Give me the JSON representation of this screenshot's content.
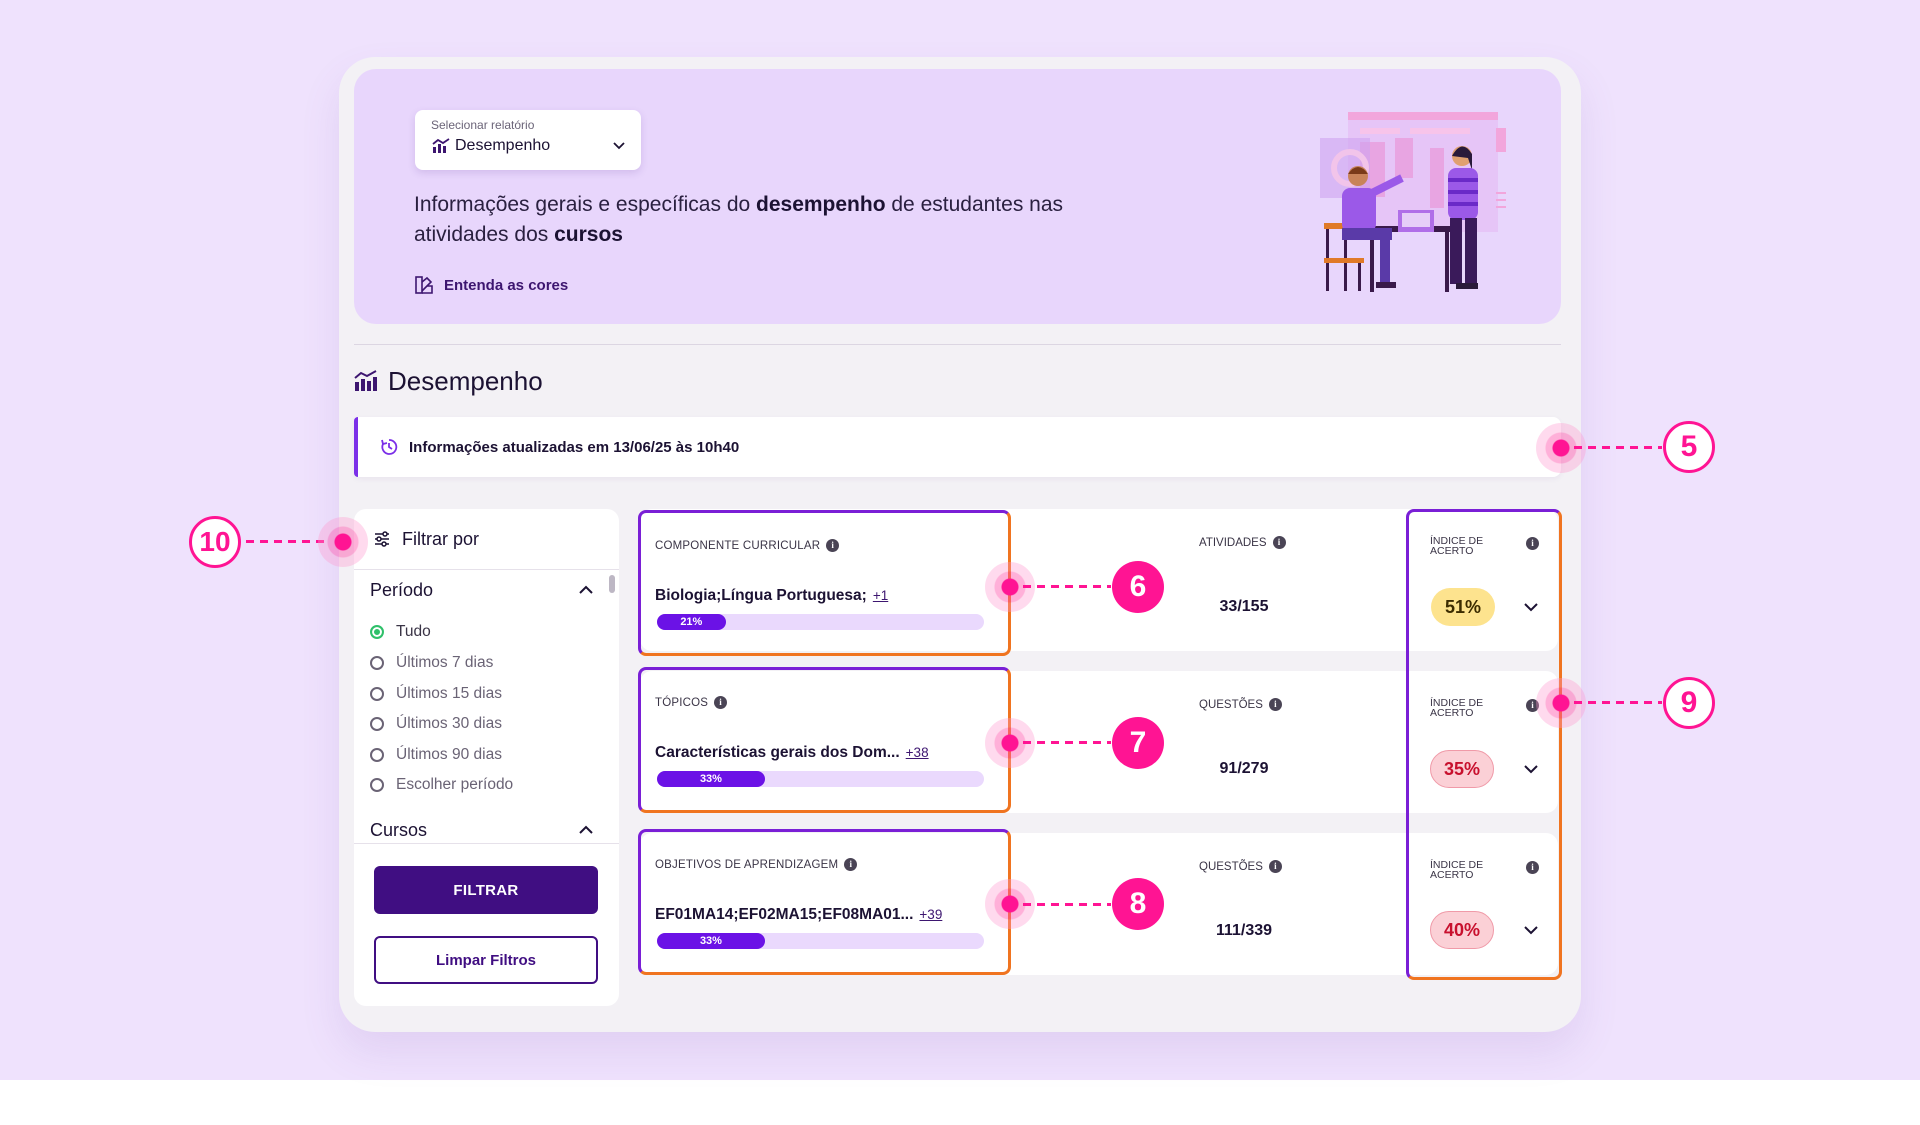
{
  "header": {
    "select_label": "Selecionar relatório",
    "select_value": "Desempenho",
    "description_parts": [
      "Informações gerais e específicas do ",
      "desempenho",
      " de estudantes nas atividades dos ",
      "cursos"
    ],
    "colors_link": "Entenda as cores"
  },
  "section_title": "Desempenho",
  "update_text": "Informações atualizadas em 13/06/25 às 10h40",
  "filter": {
    "title": "Filtrar por",
    "period_label": "Período",
    "period_options": [
      "Tudo",
      "Últimos 7 dias",
      "Últimos 15 dias",
      "Últimos 30 dias",
      "Últimos 90 dias",
      "Escolher período"
    ],
    "period_selected": "Tudo",
    "courses_label": "Cursos",
    "filter_button": "FILTRAR",
    "clear_button": "Limpar Filtros"
  },
  "cards": [
    {
      "label": "COMPONENTE CURRICULAR",
      "value": "Biologia;Língua Portuguesa;",
      "more": "+1",
      "progress_label": "21%",
      "progress_fraction": 0.21,
      "metric_label": "ATIVIDADES",
      "metric_value": "33/155",
      "accuracy_label": "ÍNDICE DE ACERTO",
      "accuracy": "51%",
      "accuracy_color": "#fde38e"
    },
    {
      "label": "TÓPICOS",
      "value": "Características gerais dos Dom...",
      "more": "+38",
      "progress_label": "33%",
      "progress_fraction": 0.33,
      "metric_label": "QUESTÕES",
      "metric_value": "91/279",
      "accuracy_label": "ÍNDICE DE ACERTO",
      "accuracy": "35%",
      "accuracy_color": "#fbd0d6"
    },
    {
      "label": "OBJETIVOS DE APRENDIZAGEM",
      "value": "EF01MA14;EF02MA15;EF08MA01...",
      "more": "+39",
      "progress_label": "33%",
      "progress_fraction": 0.33,
      "metric_label": "QUESTÕES",
      "metric_value": "111/339",
      "accuracy_label": "ÍNDICE DE ACERTO",
      "accuracy": "40%",
      "accuracy_color": "#fbd0d6"
    }
  ],
  "annotations": [
    "5",
    "6",
    "7",
    "8",
    "9",
    "10"
  ],
  "colors": {
    "accent_purple": "#400e82",
    "progress_purple": "#6b12e6",
    "highlight_pink": "#ff1493",
    "box_orange": "#f07420"
  }
}
